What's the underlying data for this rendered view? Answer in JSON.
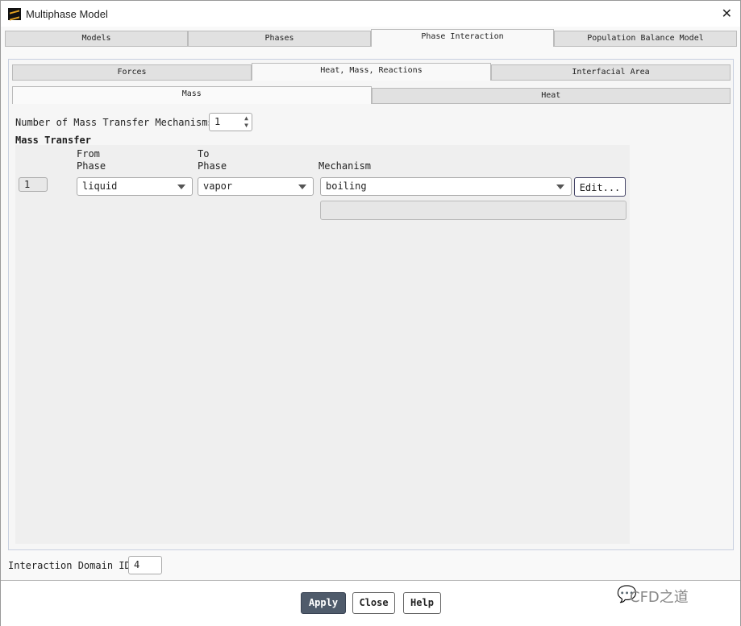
{
  "window": {
    "title": "Multiphase Model",
    "close": "✕"
  },
  "main_tabs": [
    "Models",
    "Phases",
    "Phase Interaction",
    "Population Balance Model"
  ],
  "sub_tabs": [
    "Forces",
    "Heat, Mass, Reactions",
    "Interfacial Area"
  ],
  "inner_tabs": [
    "Mass",
    "Heat"
  ],
  "mechanisms": {
    "label": "Number of Mass Transfer Mechanisms",
    "value": "1"
  },
  "mass_transfer": {
    "title": "Mass Transfer",
    "headers": {
      "from": "From\nPhase",
      "to": "To\nPhase",
      "mechanism": "Mechanism"
    },
    "rows": [
      {
        "index": "1",
        "from": "liquid",
        "to": "vapor",
        "mechanism": "boiling",
        "edit": "Edit..."
      }
    ]
  },
  "domain": {
    "label": "Interaction Domain ID",
    "value": "4"
  },
  "buttons": {
    "apply": "Apply",
    "close": "Close",
    "help": "Help"
  },
  "watermark": "CFD之道"
}
